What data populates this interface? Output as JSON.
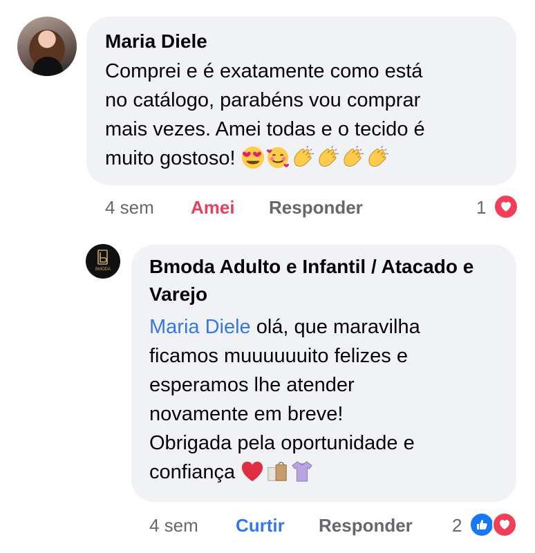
{
  "comment": {
    "author": "Maria Diele",
    "text": "Comprei e é exatamente como está\nno catálogo, parabéns vou comprar\nmais vezes. Amei todas e o tecido é\nmuito gostoso! ",
    "emojis": [
      "heart-eyes-emoji",
      "smiling-face-with-hearts-emoji",
      "clapping-hands-emoji",
      "clapping-hands-emoji",
      "clapping-hands-emoji",
      "clapping-hands-emoji"
    ],
    "time": "4 sem",
    "reaction_label": "Amei",
    "reply_label": "Responder",
    "reaction_count": "1",
    "reaction_icons": [
      "heart-reaction-icon"
    ]
  },
  "reply": {
    "author": "Bmoda Adulto e Infantil / Atacado e Varejo",
    "avatar_label": "BMODA",
    "mention": "Maria Diele",
    "text": " olá, que maravilha\nficamos muuuuuuito felizes e\nesperamos lhe atender\nnovamente em breve!\nObrigada pela oportunidade e\nconfiança ",
    "emojis": [
      "red-heart-emoji",
      "shopping-bags-emoji",
      "dress-emoji"
    ],
    "time": "4 sem",
    "reaction_label": "Curtir",
    "reply_label": "Responder",
    "reaction_count": "2",
    "reaction_icons": [
      "like-reaction-icon",
      "heart-reaction-icon"
    ]
  },
  "colors": {
    "bubble": "#f0f2f5",
    "love": "#e4405f",
    "like": "#3578e5",
    "meta": "#65676b"
  }
}
